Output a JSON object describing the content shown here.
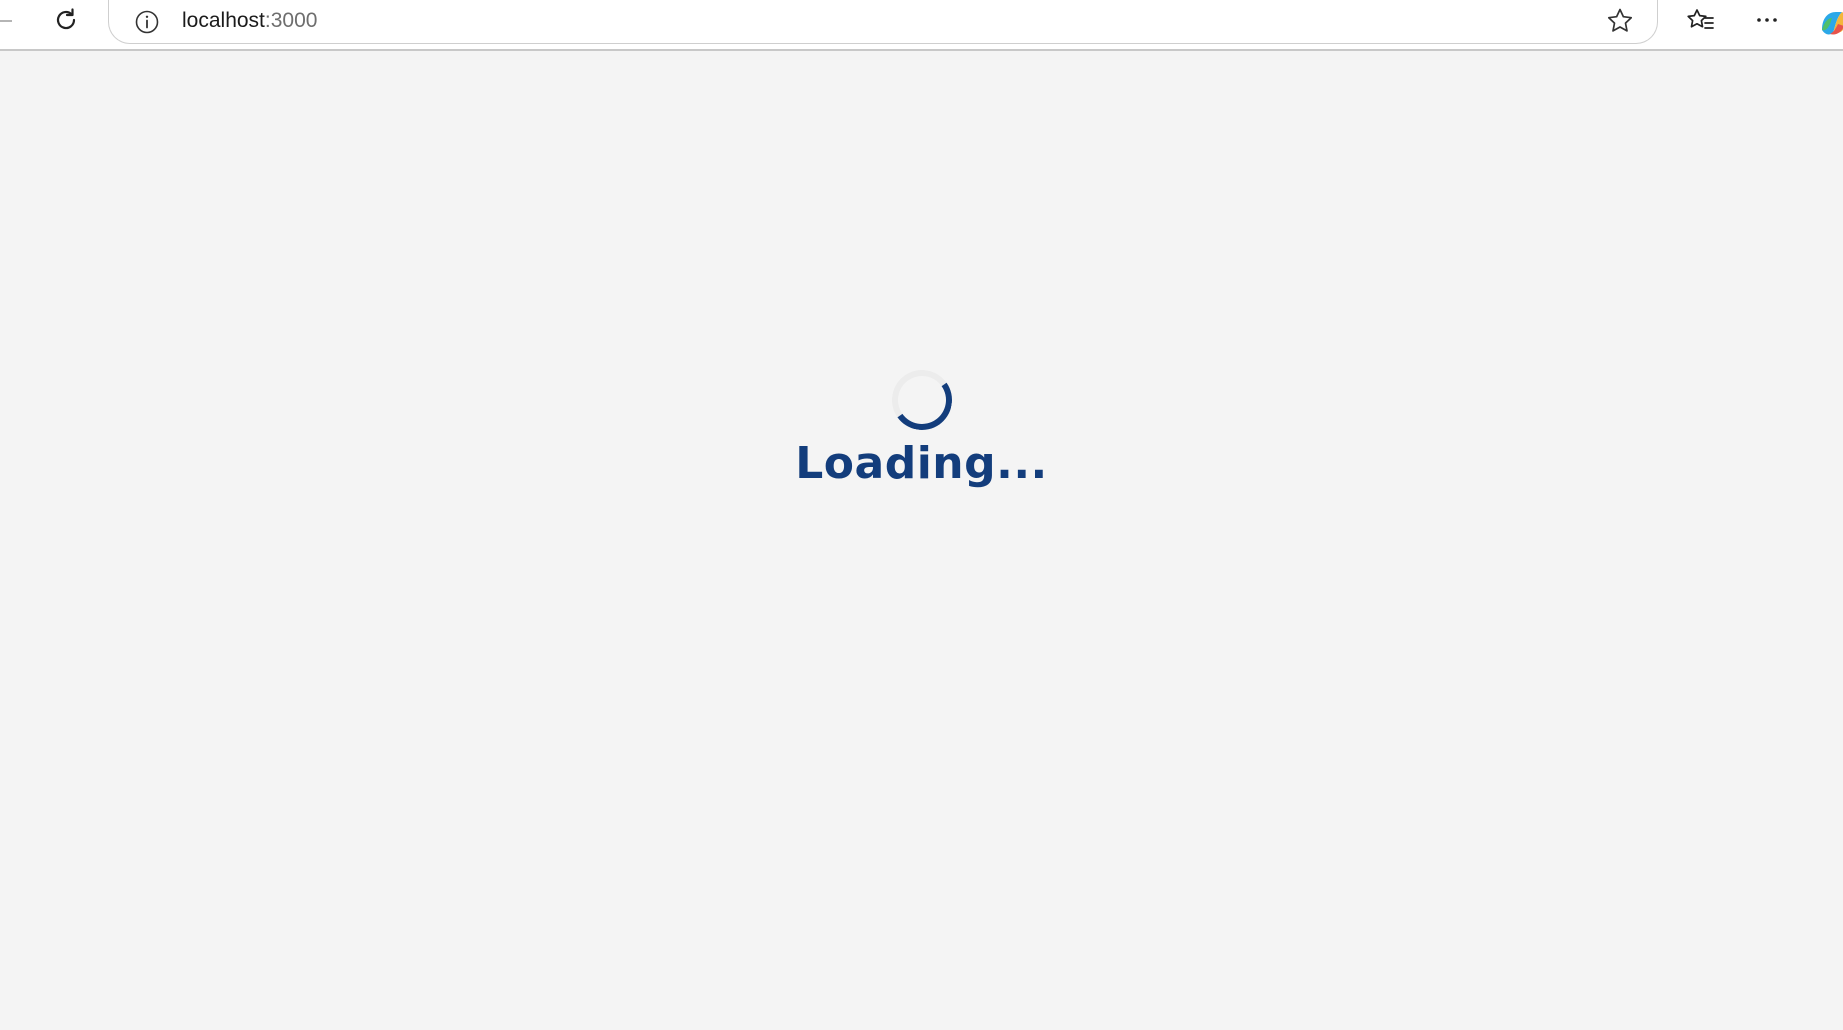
{
  "browser": {
    "url_host": "localhost",
    "url_port": ":3000"
  },
  "page": {
    "loading_text": "Loading..."
  },
  "colors": {
    "accent": "#133d7c",
    "page_background": "#f4f4f4"
  },
  "icons": [
    "refresh-icon",
    "site-info-icon",
    "favorite-star-icon",
    "favorites-icon",
    "more-options-icon",
    "copilot-icon"
  ]
}
